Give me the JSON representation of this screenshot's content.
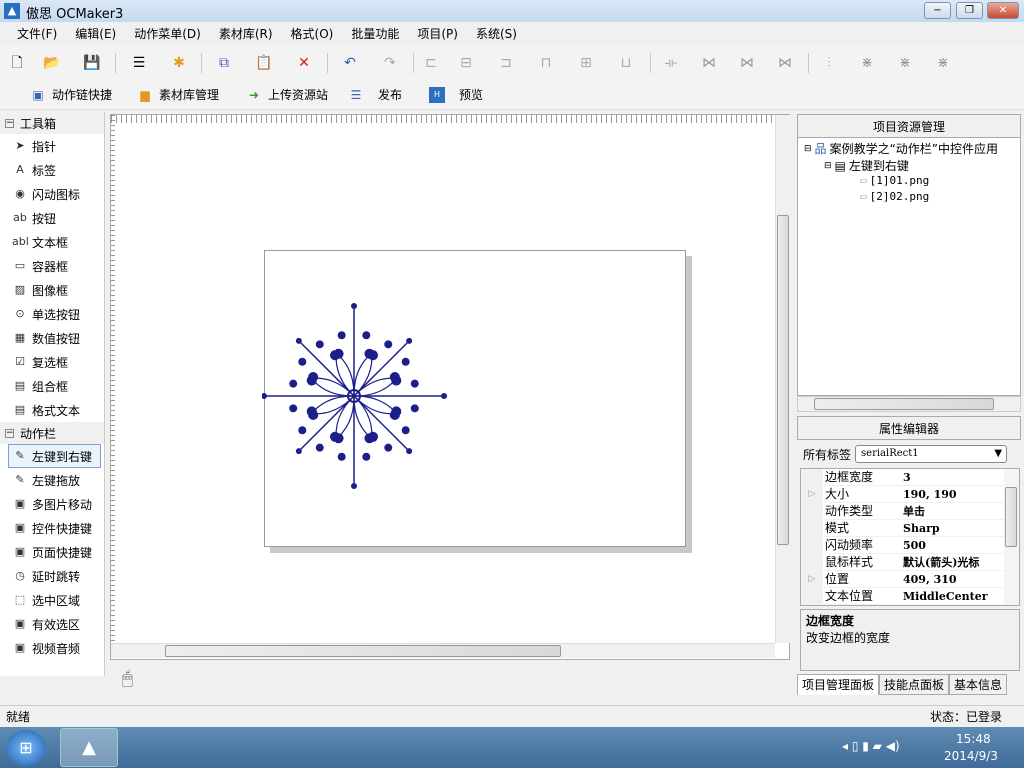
{
  "window": {
    "title": "傲思 OCMaker3",
    "app_icon": "app-icon",
    "min": "−",
    "max": "❐",
    "close": "✕"
  },
  "menu": [
    "文件(F)",
    "编辑(E)",
    "动作菜单(D)",
    "素材库(R)",
    "格式(O)",
    "批量功能",
    "项目(P)",
    "系统(S)"
  ],
  "toolbar2": [
    {
      "label": "动作链快捷",
      "icon": "chain-icon"
    },
    {
      "label": "素材库管理",
      "icon": "folder-icon"
    },
    {
      "label": "上传资源站",
      "icon": "upload-icon"
    },
    {
      "label": "发布",
      "icon": "publish-icon"
    },
    {
      "label": "预览",
      "icon": "preview-icon"
    }
  ],
  "toolbox": {
    "group1": "工具箱",
    "tools": [
      "指针",
      "标签",
      "闪动图标",
      "按钮",
      "文本框",
      "容器框",
      "图像框",
      "单选按钮",
      "数值按钮",
      "复选框",
      "组合框",
      "格式文本"
    ],
    "group2": "动作栏",
    "actions": [
      "左键到右键",
      "左键拖放",
      "多图片移动",
      "控件快捷键",
      "页面快捷键",
      "延时跳转",
      "选中区域",
      "有效选区",
      "视频音频"
    ]
  },
  "project": {
    "title": "项目资源管理",
    "root": "案例教学之“动作栏”中控件应用",
    "child": "左键到右键",
    "files": [
      "[1]01.png",
      "[2]02.png"
    ]
  },
  "props": {
    "title": "属性编辑器",
    "tag_label": "所有标签",
    "tag_value": "serialRect1",
    "rows": [
      {
        "k": "边框宽度",
        "v": "3",
        "ex": ""
      },
      {
        "k": "大小",
        "v": "190, 190",
        "ex": "▷"
      },
      {
        "k": "动作类型",
        "v": "单击",
        "ex": ""
      },
      {
        "k": "模式",
        "v": "Sharp",
        "ex": ""
      },
      {
        "k": "闪动频率",
        "v": "500",
        "ex": ""
      },
      {
        "k": "鼠标样式",
        "v": "默认(箭头)光标",
        "ex": ""
      },
      {
        "k": "位置",
        "v": "409, 310",
        "ex": "▷"
      },
      {
        "k": "文本位置",
        "v": "MiddleCenter",
        "ex": ""
      }
    ],
    "desc_title": "边框宽度",
    "desc_text": "改变边框的宽度"
  },
  "tabs": [
    "项目管理面板",
    "技能点面板",
    "基本信息"
  ],
  "status": {
    "left": "就绪",
    "right": "状态：已登录"
  },
  "taskbar": {
    "time": "15:48",
    "date": "2014/9/3"
  },
  "colors": {
    "flower": "#1c1f8a",
    "accent": "#2a6fc1"
  }
}
